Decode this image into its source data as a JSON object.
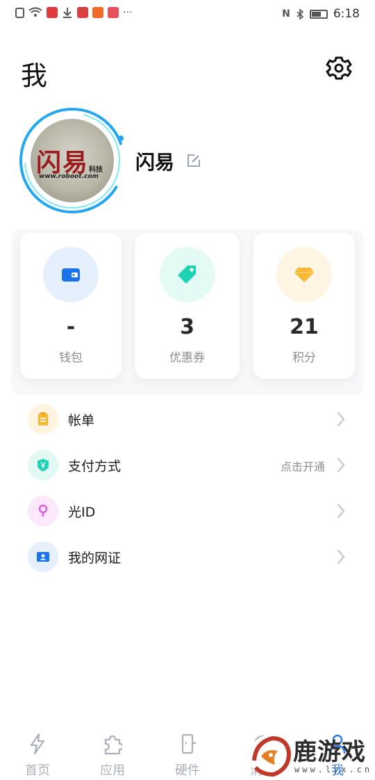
{
  "status_bar": {
    "time": "6:18",
    "more": "···"
  },
  "header": {
    "title": "我"
  },
  "profile": {
    "name": "闪易",
    "logo_main": "闪易",
    "logo_sub": "科技",
    "logo_url": "www.roboot.com"
  },
  "stats": [
    {
      "value": "-",
      "label": "钱包",
      "icon": "wallet-icon",
      "color": "#1a73e8",
      "bg": "#e6f0fd"
    },
    {
      "value": "3",
      "label": "优惠券",
      "icon": "tag-icon",
      "color": "#1ed3b3",
      "bg": "#e3faf5"
    },
    {
      "value": "21",
      "label": "积分",
      "icon": "diamond-icon",
      "color": "#f7b731",
      "bg": "#fff5e2"
    }
  ],
  "menu": [
    {
      "label": "帐单",
      "hint": "",
      "icon": "bill-icon"
    },
    {
      "label": "支付方式",
      "hint": "点击开通",
      "icon": "yuan-shield-icon"
    },
    {
      "label": "光ID",
      "hint": "",
      "icon": "light-id-icon"
    },
    {
      "label": "我的网证",
      "hint": "",
      "icon": "id-card-icon"
    }
  ],
  "tabs": [
    {
      "label": "首页",
      "icon": "home-icon"
    },
    {
      "label": "应用",
      "icon": "puzzle-icon"
    },
    {
      "label": "硬件",
      "icon": "device-icon"
    },
    {
      "label": "消息",
      "icon": "message-icon"
    },
    {
      "label": "我",
      "icon": "user-icon",
      "active": true
    }
  ],
  "watermark": {
    "text": "鹿游戏",
    "url": "www.lyx.cn"
  },
  "colors": {
    "accent": "#2b7cf0",
    "ring": "#22a7f0"
  }
}
